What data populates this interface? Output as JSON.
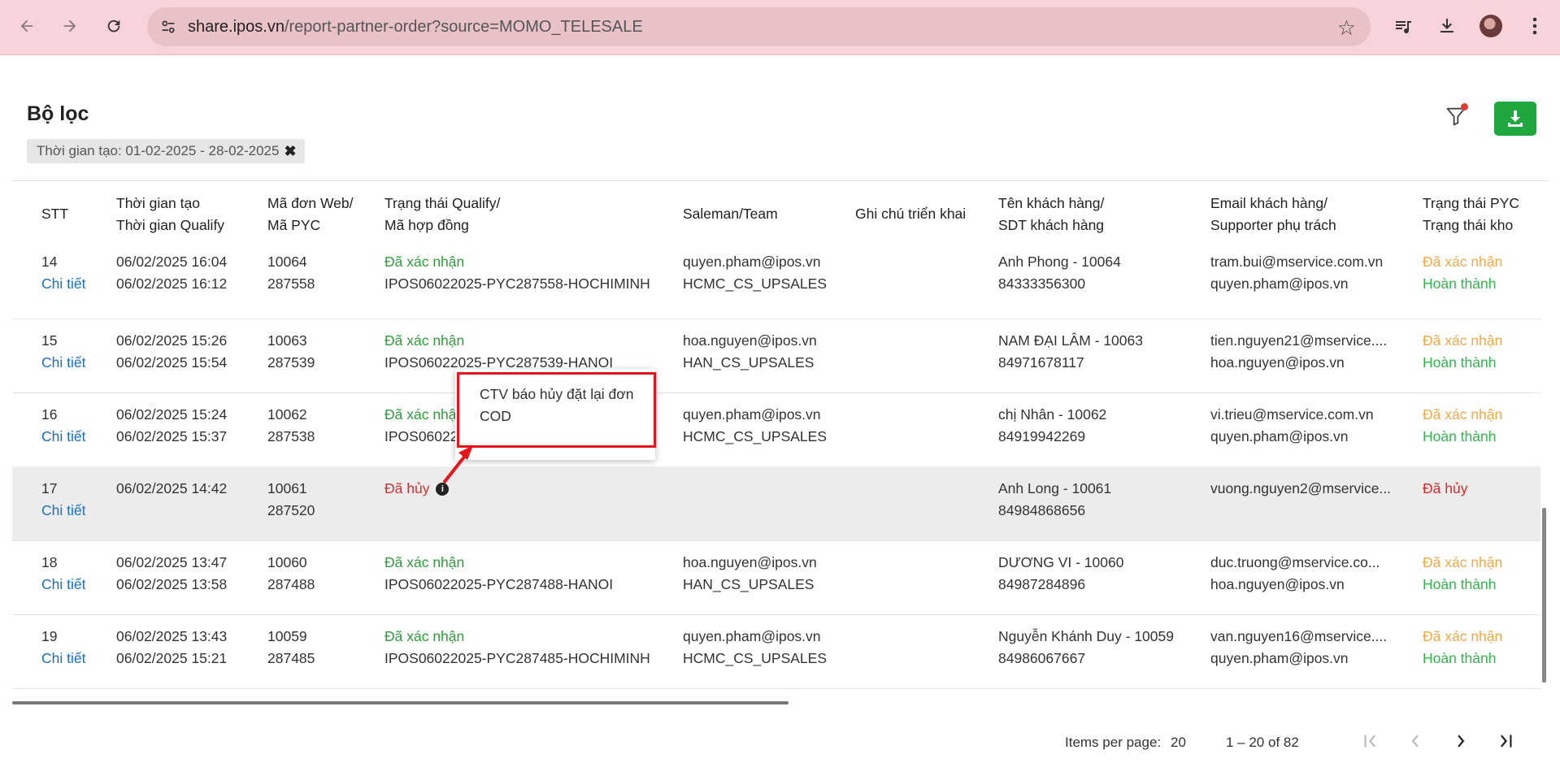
{
  "browser": {
    "url_host": "share.ipos.vn",
    "url_path": "/report-partner-order?source=MOMO_TELESALE"
  },
  "page": {
    "title": "Bộ lọc",
    "filter_chip": "Thời gian tạo: 01-02-2025 - 28-02-2025"
  },
  "table": {
    "headers": {
      "stt": "STT",
      "time_line1": "Thời gian tạo",
      "time_line2": "Thời gian Qualify",
      "code_line1": "Mã đơn Web/",
      "code_line2": "Mã PYC",
      "qualify_line1": "Trạng thái Qualify/",
      "qualify_line2": "Mã hợp đồng",
      "saleman": "Saleman/Team",
      "note": "Ghi chú triển khai",
      "customer_line1": "Tên khách hàng/",
      "customer_line2": "SDT khách hàng",
      "email_line1": "Email khách hàng/",
      "email_line2": "Supporter phụ trách",
      "pyc_line1": "Trạng thái PYC",
      "pyc_line2": "Trạng thái kho"
    },
    "detail_label": "Chi tiết",
    "rows": [
      {
        "stt": "14",
        "created": "06/02/2025 16:04",
        "qualified": "06/02/2025 16:12",
        "web_code": "10064",
        "pyc_code": "287558",
        "qualify_status": "Đã xác nhận",
        "contract": "IPOS06022025-PYC287558-HOCHIMINH",
        "saleman": "quyen.pham@ipos.vn",
        "team": "HCMC_CS_UPSALES",
        "customer": "Anh Phong - 10064",
        "phone": "84333356300",
        "email": "tram.bui@mservice.com.vn",
        "supporter": "quyen.pham@ipos.vn",
        "pyc_status": "Đã xác nhận",
        "stock_status": "Hoàn thành"
      },
      {
        "stt": "15",
        "created": "06/02/2025 15:26",
        "qualified": "06/02/2025 15:54",
        "web_code": "10063",
        "pyc_code": "287539",
        "qualify_status": "Đã xác nhận",
        "contract": "IPOS06022025-PYC287539-HANOI",
        "saleman": "hoa.nguyen@ipos.vn",
        "team": "HAN_CS_UPSALES",
        "customer": "NAM ĐẠI LÂM - 10063",
        "phone": "84971678117",
        "email": "tien.nguyen21@mservice....",
        "supporter": "hoa.nguyen@ipos.vn",
        "pyc_status": "Đã xác nhận",
        "stock_status": "Hoàn thành"
      },
      {
        "stt": "16",
        "created": "06/02/2025 15:24",
        "qualified": "06/02/2025 15:37",
        "web_code": "10062",
        "pyc_code": "287538",
        "qualify_status": "Đã xác nhận",
        "contract": "IPOS06022",
        "saleman": "quyen.pham@ipos.vn",
        "team": "HCMC_CS_UPSALES",
        "customer": "chị Nhân - 10062",
        "phone": "84919942269",
        "email": "vi.trieu@mservice.com.vn",
        "supporter": "quyen.pham@ipos.vn",
        "pyc_status": "Đã xác nhận",
        "stock_status": "Hoàn thành"
      },
      {
        "stt": "17",
        "created": "06/02/2025 14:42",
        "qualified": "",
        "web_code": "10061",
        "pyc_code": "287520",
        "qualify_status": "Đã hủy",
        "contract": "",
        "saleman": "",
        "team": "",
        "customer": "Anh Long - 10061",
        "phone": "84984868656",
        "email": "vuong.nguyen2@mservice...",
        "supporter": "",
        "pyc_status": "Đã hủy",
        "stock_status": ""
      },
      {
        "stt": "18",
        "created": "06/02/2025 13:47",
        "qualified": "06/02/2025 13:58",
        "web_code": "10060",
        "pyc_code": "287488",
        "qualify_status": "Đã xác nhận",
        "contract": "IPOS06022025-PYC287488-HANOI",
        "saleman": "hoa.nguyen@ipos.vn",
        "team": "HAN_CS_UPSALES",
        "customer": "DƯƠNG VI - 10060",
        "phone": "84987284896",
        "email": "duc.truong@mservice.co...",
        "supporter": "hoa.nguyen@ipos.vn",
        "pyc_status": "Đã xác nhận",
        "stock_status": "Hoàn thành"
      },
      {
        "stt": "19",
        "created": "06/02/2025 13:43",
        "qualified": "06/02/2025 15:21",
        "web_code": "10059",
        "pyc_code": "287485",
        "qualify_status": "Đã xác nhận",
        "contract": "IPOS06022025-PYC287485-HOCHIMINH",
        "saleman": "quyen.pham@ipos.vn",
        "team": "HCMC_CS_UPSALES",
        "customer": "Nguyễn Khánh Duy - 10059",
        "phone": "84986067667",
        "email": "van.nguyen16@mservice....",
        "supporter": "quyen.pham@ipos.vn",
        "pyc_status": "Đã xác nhận",
        "stock_status": "Hoàn thành"
      }
    ]
  },
  "tooltip": {
    "text": "CTV báo hủy đặt lại đơn COD"
  },
  "paginator": {
    "items_per_page_label": "Items per page:",
    "items_per_page_value": "20",
    "range": "1 – 20 of 82"
  },
  "colors": {
    "confirmed": "#2e9e3a",
    "pyc_confirmed": "#f3a84a",
    "done": "#35b34f",
    "cancelled": "#d32f2f",
    "link": "#1a6fc0",
    "export_button": "#1ea83f",
    "annotation_box": "#e8141c"
  }
}
